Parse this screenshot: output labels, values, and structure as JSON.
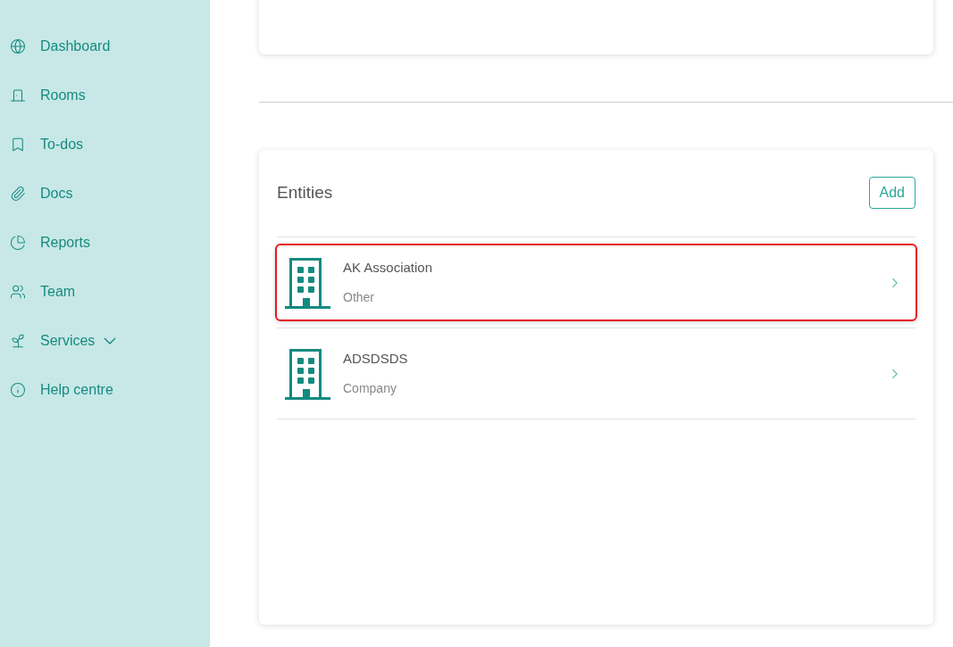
{
  "sidebar": {
    "items": [
      {
        "label": "Dashboard",
        "submenu": false
      },
      {
        "label": "Rooms",
        "submenu": false
      },
      {
        "label": "To-dos",
        "submenu": false
      },
      {
        "label": "Docs",
        "submenu": false
      },
      {
        "label": "Reports",
        "submenu": false
      },
      {
        "label": "Team",
        "submenu": false
      },
      {
        "label": "Services",
        "submenu": true
      },
      {
        "label": "Help centre",
        "submenu": false
      }
    ]
  },
  "entities": {
    "title": "Entities",
    "add_button": "Add",
    "items": [
      {
        "name": "AK Association",
        "type": "Other",
        "selected": true
      },
      {
        "name": "ADSDSDS",
        "type": "Company",
        "selected": false
      }
    ]
  }
}
